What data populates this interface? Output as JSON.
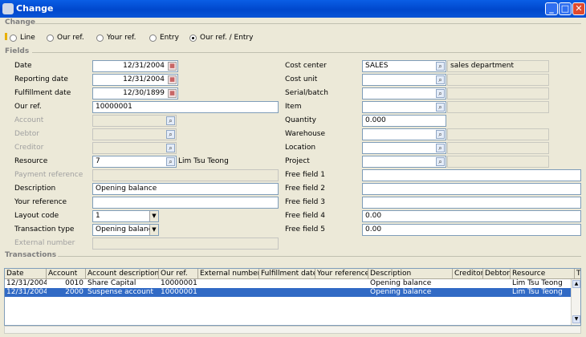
{
  "window": {
    "title": "Change"
  },
  "sections": {
    "change": "Change",
    "fields": "Fields",
    "transactions": "Transactions"
  },
  "radio_options": [
    {
      "label": "Line",
      "checked": false
    },
    {
      "label": "Our ref.",
      "checked": false
    },
    {
      "label": "Your ref.",
      "checked": false
    },
    {
      "label": "Entry",
      "checked": false
    },
    {
      "label": "Our ref. / Entry",
      "checked": true
    }
  ],
  "left_fields": {
    "date": {
      "label": "Date",
      "value": "12/31/2004"
    },
    "reporting_date": {
      "label": "Reporting date",
      "value": "12/31/2004"
    },
    "fulfillment_date": {
      "label": "Fulfillment date",
      "value": "12/30/1899"
    },
    "our_ref": {
      "label": "Our ref.",
      "value": "10000001"
    },
    "account": {
      "label": "Account",
      "value": ""
    },
    "debtor": {
      "label": "Debtor",
      "value": ""
    },
    "creditor": {
      "label": "Creditor",
      "value": ""
    },
    "resource": {
      "label": "Resource",
      "value": "7",
      "description": "Lim Tsu Teong"
    },
    "payment_reference": {
      "label": "Payment reference",
      "value": ""
    },
    "description": {
      "label": "Description",
      "value": "Opening balance"
    },
    "your_reference": {
      "label": "Your reference",
      "value": ""
    },
    "layout_code": {
      "label": "Layout code",
      "value": "1"
    },
    "transaction_type": {
      "label": "Transaction type",
      "value": "Opening balanc"
    },
    "external_number": {
      "label": "External number",
      "value": ""
    }
  },
  "right_fields": {
    "cost_center": {
      "label": "Cost center",
      "value": "SALES",
      "description": "sales department"
    },
    "cost_unit": {
      "label": "Cost unit",
      "value": ""
    },
    "serial_batch": {
      "label": "Serial/batch",
      "value": ""
    },
    "item": {
      "label": "Item",
      "value": ""
    },
    "quantity": {
      "label": "Quantity",
      "value": "0.000"
    },
    "warehouse": {
      "label": "Warehouse",
      "value": ""
    },
    "location": {
      "label": "Location",
      "value": ""
    },
    "project": {
      "label": "Project",
      "value": ""
    },
    "free_field_1": {
      "label": "Free field 1",
      "value": ""
    },
    "free_field_2": {
      "label": "Free field 2",
      "value": ""
    },
    "free_field_3": {
      "label": "Free field 3",
      "value": ""
    },
    "free_field_4": {
      "label": "Free field 4",
      "value": "0.00"
    },
    "free_field_5": {
      "label": "Free field 5",
      "value": "0.00"
    }
  },
  "transactions": {
    "columns": [
      "Date",
      "Account",
      "Account description",
      "Our ref.",
      "External number",
      "Fulfillment date",
      "Your reference",
      "Description",
      "Creditor",
      "Debtor",
      "Resource",
      "T"
    ],
    "rows": [
      {
        "date": "12/31/2004",
        "account": "0010",
        "account_description": "Share Capital",
        "our_ref": "10000001",
        "external_number": "",
        "fulfillment_date": "",
        "your_reference": "",
        "description": "Opening balance",
        "creditor": "",
        "debtor": "",
        "resource": "Lim Tsu Teong",
        "selected": false
      },
      {
        "date": "12/31/2004",
        "account": "2000",
        "account_description": "Suspense account",
        "our_ref": "10000001",
        "external_number": "",
        "fulfillment_date": "",
        "your_reference": "",
        "description": "Opening balance",
        "creditor": "",
        "debtor": "",
        "resource": "Lim Tsu Teong",
        "selected": true
      }
    ]
  }
}
